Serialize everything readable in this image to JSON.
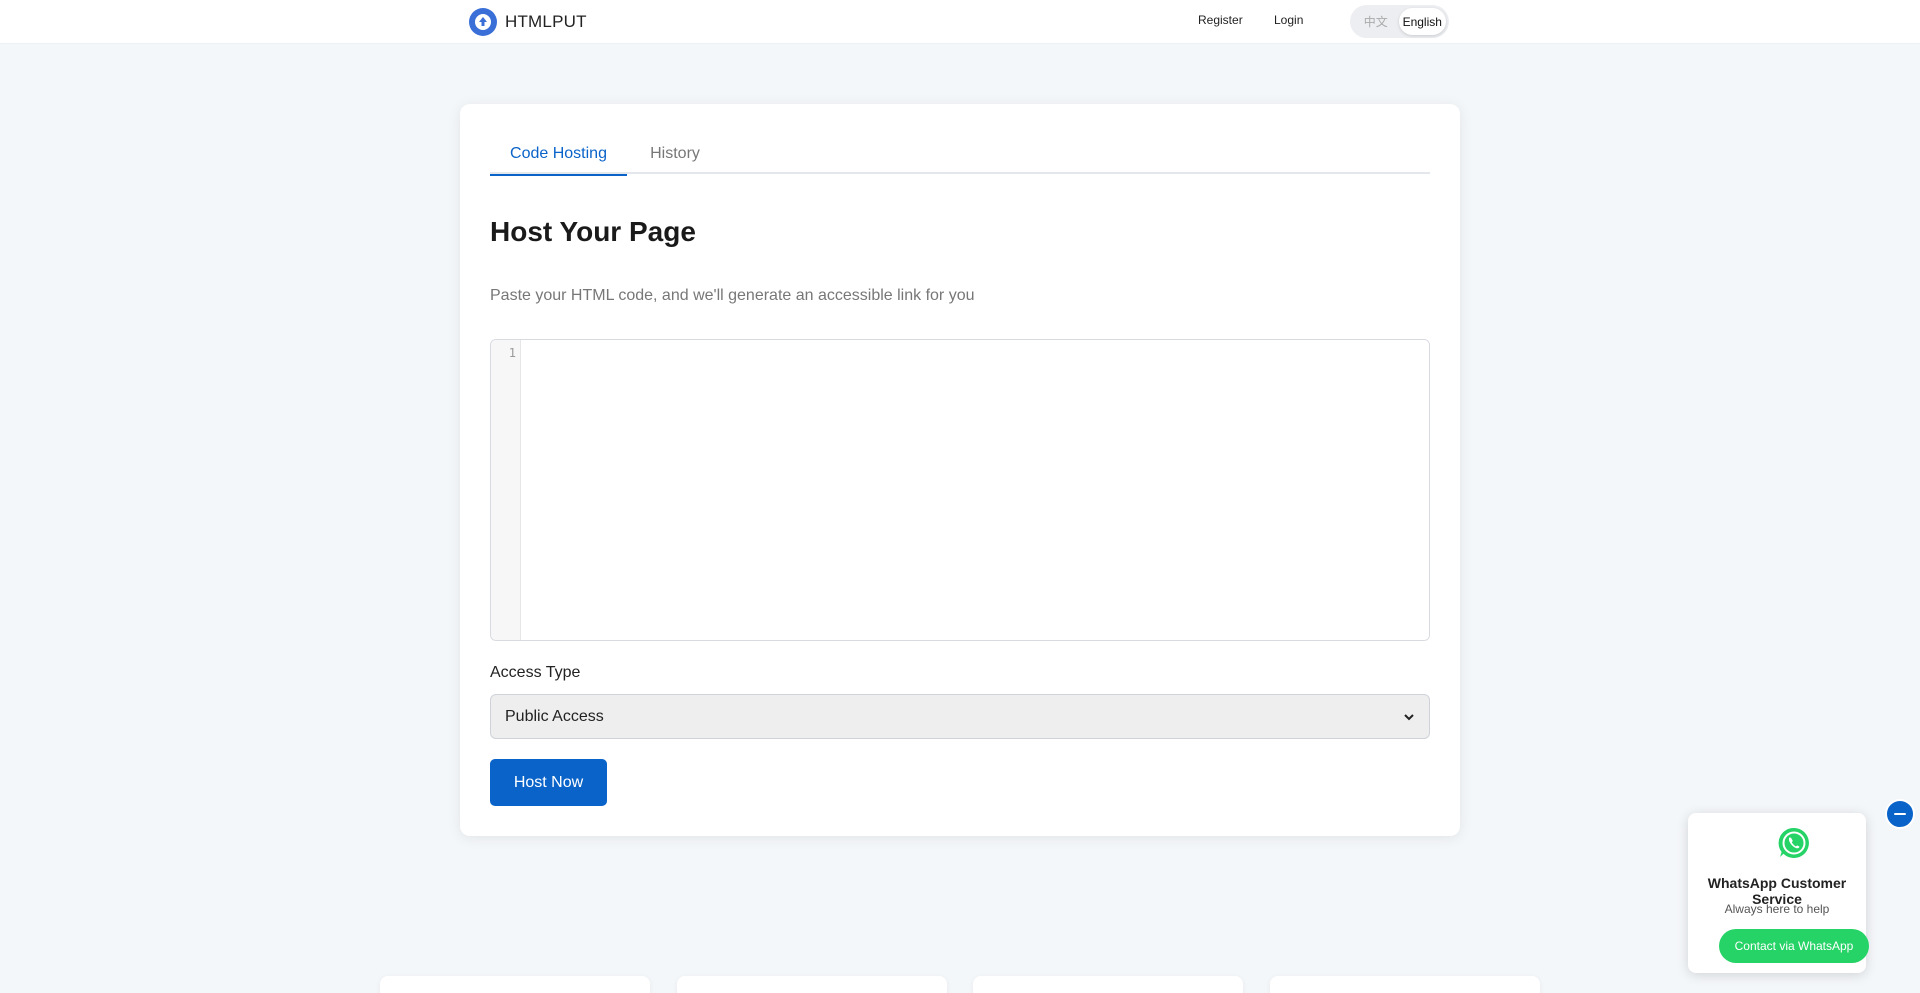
{
  "header": {
    "brand_name": "HTMLPUT",
    "nav": {
      "register": "Register",
      "login": "Login"
    },
    "language": {
      "inactive": "中文",
      "active": "English"
    }
  },
  "main": {
    "tabs": [
      {
        "label": "Code Hosting",
        "active": true
      },
      {
        "label": "History",
        "active": false
      }
    ],
    "title": "Host Your Page",
    "subtitle": "Paste your HTML code, and we'll generate an accessible link for you",
    "editor": {
      "line_number": "1",
      "value": ""
    },
    "access": {
      "label": "Access Type",
      "selected": "Public Access"
    },
    "submit_label": "Host Now"
  },
  "whatsapp": {
    "title": "WhatsApp Customer Service",
    "subtitle": "Always here to help",
    "button_label": "Contact via WhatsApp",
    "brand_color": "#25d366"
  },
  "colors": {
    "accent": "#0a63c9",
    "logo": "#3a6fd8"
  }
}
